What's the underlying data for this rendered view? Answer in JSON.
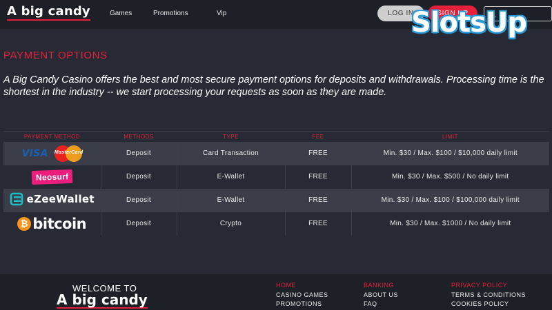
{
  "header": {
    "logo": "A big candy",
    "nav": [
      "Games",
      "Promotions",
      "Vip"
    ],
    "login_label": "LOG IN",
    "signup_label": "SIGN UP"
  },
  "watermark": "SlotsUp",
  "page": {
    "title": "PAYMENT OPTIONS",
    "intro": "A Big Candy Casino offers the best and most secure payment options for deposits and withdrawals. Processing time is the shortest in the industry -- we start processing your requests as soon as they are made."
  },
  "table": {
    "headers": [
      "PAYMENT METHOD",
      "METHODS",
      "TYPE",
      "FEE",
      "LIMIT"
    ],
    "rows": [
      {
        "brand": "visa-mastercard",
        "brand_text": "VISA",
        "brand_text2": "MasterCard",
        "method": "Deposit",
        "type": "Card Transaction",
        "fee": "FREE",
        "limit": "Min. $30 / Max. $100 / $10,000 daily limit"
      },
      {
        "brand": "neosurf",
        "brand_text": "Neosurf",
        "method": "Deposit",
        "type": "E-Wallet",
        "fee": "FREE",
        "limit": "Min. $30 / Max. $500 / No daily limit"
      },
      {
        "brand": "ezeewallet",
        "brand_text": "eZeeWallet",
        "method": "Deposit",
        "type": "E-Wallet",
        "fee": "FREE",
        "limit": "Min. $30 / Max. $100 / $100,000 daily limit"
      },
      {
        "brand": "bitcoin",
        "brand_text": "bitcoin",
        "brand_symbol": "₿",
        "method": "Deposit",
        "type": "Crypto",
        "fee": "FREE",
        "limit": "Min. $30 / Max. $1000 / No daily limit"
      }
    ]
  },
  "footer": {
    "welcome": "WELCOME TO",
    "logo": "A big candy",
    "columns": [
      {
        "heading": "HOME",
        "links": [
          "CASINO GAMES",
          "PROMOTIONS"
        ]
      },
      {
        "heading": "BANKING",
        "links": [
          "ABOUT US",
          "FAQ"
        ]
      },
      {
        "heading": "PRIVACY POLICY",
        "links": [
          "TERMS & CONDITIONS",
          "COOKIES POLICY"
        ]
      }
    ]
  },
  "colors": {
    "accent": "#e4203b",
    "background": "#272a34",
    "header_bg": "#1e2027",
    "row_shade": "#3b3e48"
  }
}
